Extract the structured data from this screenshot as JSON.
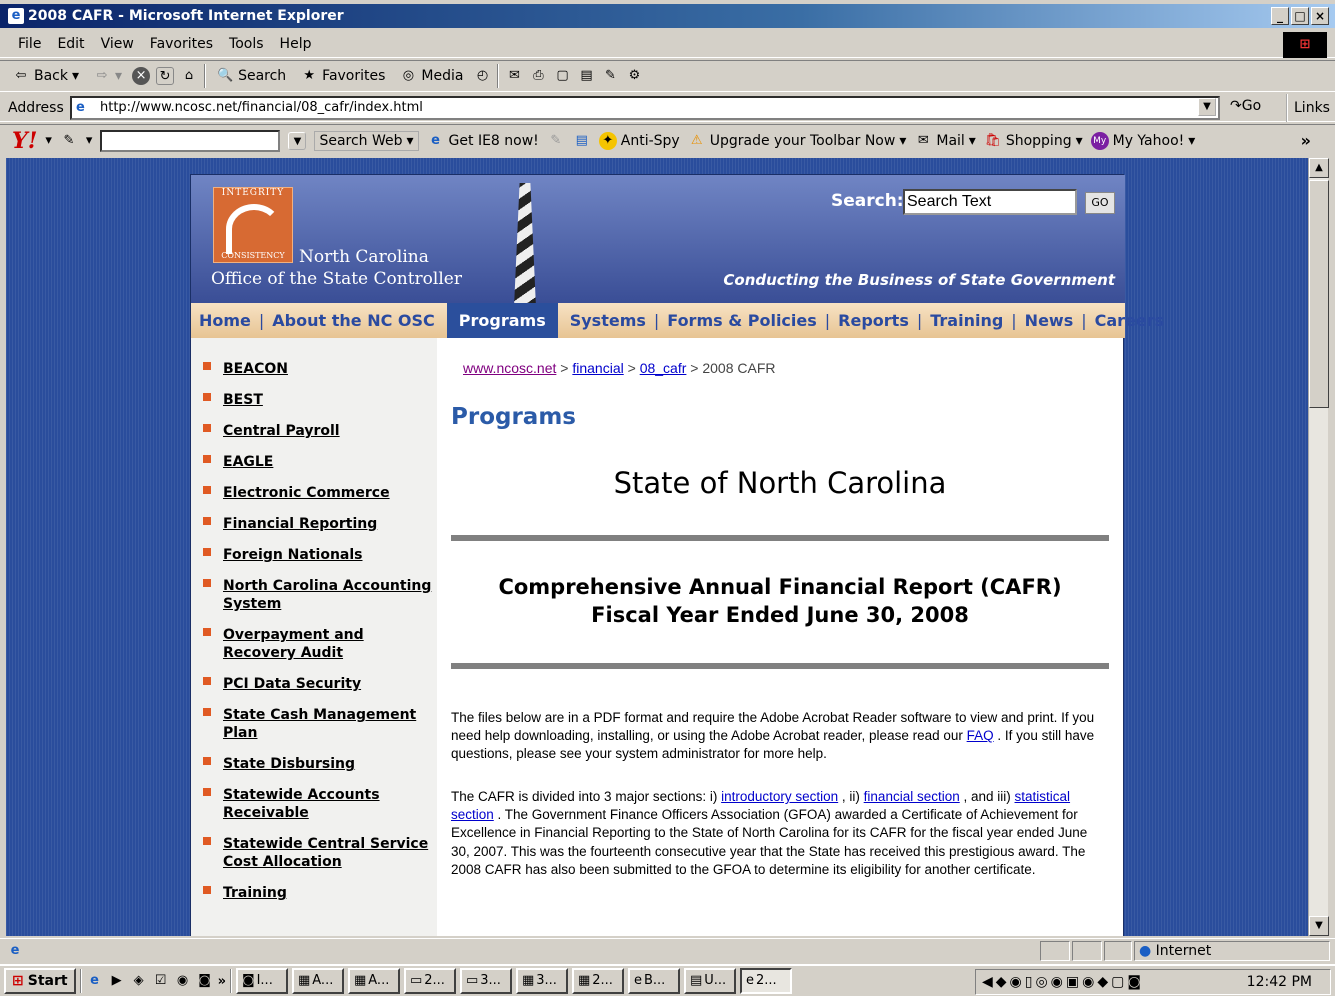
{
  "window": {
    "title": "2008 CAFR - Microsoft Internet Explorer",
    "controls": [
      "_",
      "□",
      "×"
    ]
  },
  "menu": [
    "File",
    "Edit",
    "View",
    "Favorites",
    "Tools",
    "Help"
  ],
  "toolbar": {
    "back": "Back",
    "search": "Search",
    "favorites": "Favorites",
    "media": "Media"
  },
  "address": {
    "label": "Address",
    "url": "http://www.ncosc.net/financial/08_cafr/index.html",
    "go": "Go",
    "links": "Links"
  },
  "yahoo": {
    "search_web": "Search Web",
    "get_ie8": "Get IE8 now!",
    "antispy": "Anti-Spy",
    "upgrade": "Upgrade your Toolbar Now",
    "mail": "Mail",
    "shopping": "Shopping",
    "my_yahoo": "My Yahoo!",
    "more": "»"
  },
  "site": {
    "logo_top": "INTEGRITY",
    "logo_bottom": "CONSISTENCY",
    "org_line1": "North Carolina",
    "org_line2": "Office of the State Controller",
    "search_label": "Search:",
    "search_value": "Search Text",
    "go": "GO",
    "tagline": "Conducting the Business of State Government",
    "nav": [
      "Home",
      "About the NC OSC",
      "Programs",
      "Systems",
      "Forms & Policies",
      "Reports",
      "Training",
      "News",
      "Careers"
    ],
    "active_nav": "Programs",
    "sidebar": [
      "BEACON",
      "BEST",
      "Central Payroll",
      "EAGLE",
      "Electronic Commerce",
      "Financial Reporting",
      "Foreign Nationals",
      "North Carolina Accounting System",
      "Overpayment and Recovery Audit",
      "PCI Data Security",
      "State Cash Management Plan",
      "State Disbursing",
      "Statewide Accounts Receivable",
      "Statewide Central Service Cost Allocation",
      "Training"
    ],
    "breadcrumb": {
      "home": "www.ncosc.net",
      "sep": ">",
      "c1": "financial",
      "c2": "08_cafr",
      "current": "2008 CAFR"
    },
    "page_title": "Programs",
    "heading1": "State of North Carolina",
    "heading2_line1": "Comprehensive Annual Financial Report (CAFR)",
    "heading2_line2": "Fiscal Year Ended June 30, 2008",
    "para1_a": "The files below are in a PDF format and require the Adobe Acrobat Reader software to view and print. If you need help downloading, installing, or using the Adobe Acrobat reader, please read our ",
    "para1_link": "FAQ",
    "para1_b": " . If you still have questions, please see your system administrator for more help.",
    "para2_a": "The CAFR is divided into 3 major sections:  i) ",
    "para2_link1": "introductory section",
    "para2_b": " , ii) ",
    "para2_link2": "financial section",
    "para2_c": " , and iii) ",
    "para2_link3": "statistical section",
    "para2_d": " .  The Government Finance Officers Association (GFOA) awarded a Certificate of Achievement for Excellence in Financial Reporting to the State of North Carolina for its CAFR for the fiscal year ended June 30, 2007.  This was the fourteenth consecutive year that the State has received this prestigious award.  The 2008 CAFR has also been submitted to the GFOA to determine its eligibility for another certificate."
  },
  "status": {
    "zone": "Internet"
  },
  "taskbar": {
    "start": "Start",
    "buttons": [
      "I...",
      "A...",
      "A...",
      "2...",
      "3...",
      "3...",
      "2...",
      "B...",
      "U...",
      "2..."
    ],
    "clock": "12:42 PM"
  }
}
